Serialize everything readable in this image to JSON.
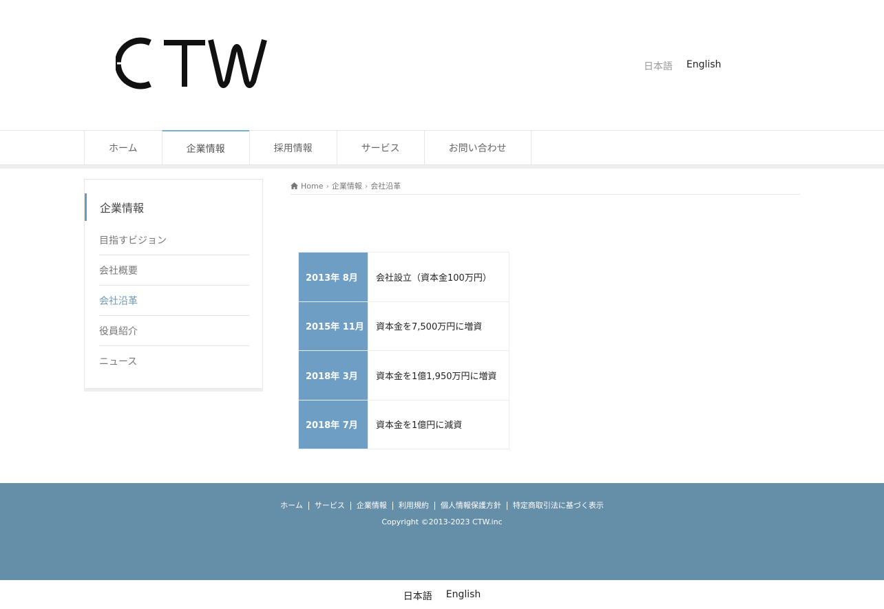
{
  "header": {
    "logo_alt": "CTW",
    "lang": {
      "ja": "日本語",
      "en": "English"
    }
  },
  "nav": {
    "items": [
      {
        "label": "ホーム"
      },
      {
        "label": "企業情報"
      },
      {
        "label": "採用情報"
      },
      {
        "label": "サービス"
      },
      {
        "label": "お問い合わせ"
      }
    ],
    "active_index": 1
  },
  "sidebar": {
    "title": "企業情報",
    "items": [
      {
        "label": "目指すビジョン"
      },
      {
        "label": "会社概要"
      },
      {
        "label": "会社沿革"
      },
      {
        "label": "役員紹介"
      },
      {
        "label": "ニュース"
      }
    ],
    "current_index": 2
  },
  "breadcrumb": {
    "home": "Home",
    "parent": "企業情報",
    "current": "会社沿革"
  },
  "history": {
    "rows": [
      {
        "date": "2013年 8月",
        "event": "会社設立（資本金100万円）"
      },
      {
        "date": "2015年 11月",
        "event": "資本金を7,500万円に増資"
      },
      {
        "date": "2018年 3月",
        "event": "資本金を1億1,950万円に増資"
      },
      {
        "date": "2018年 7月",
        "event": "資本金を1億円に減資"
      }
    ]
  },
  "footer": {
    "links": [
      "ホーム",
      "サービス",
      "企業情報",
      "利用規約",
      "個人情報保護方針",
      "特定商取引法に基づく表示"
    ],
    "copyright": "Copyright ©2013-2023 CTW.inc"
  },
  "bottom_lang": {
    "ja": "日本語",
    "en": "English"
  },
  "colors": {
    "accent": "#6b9bb8",
    "table_header": "#6e9ec4",
    "footer_bg": "#658ea8"
  }
}
